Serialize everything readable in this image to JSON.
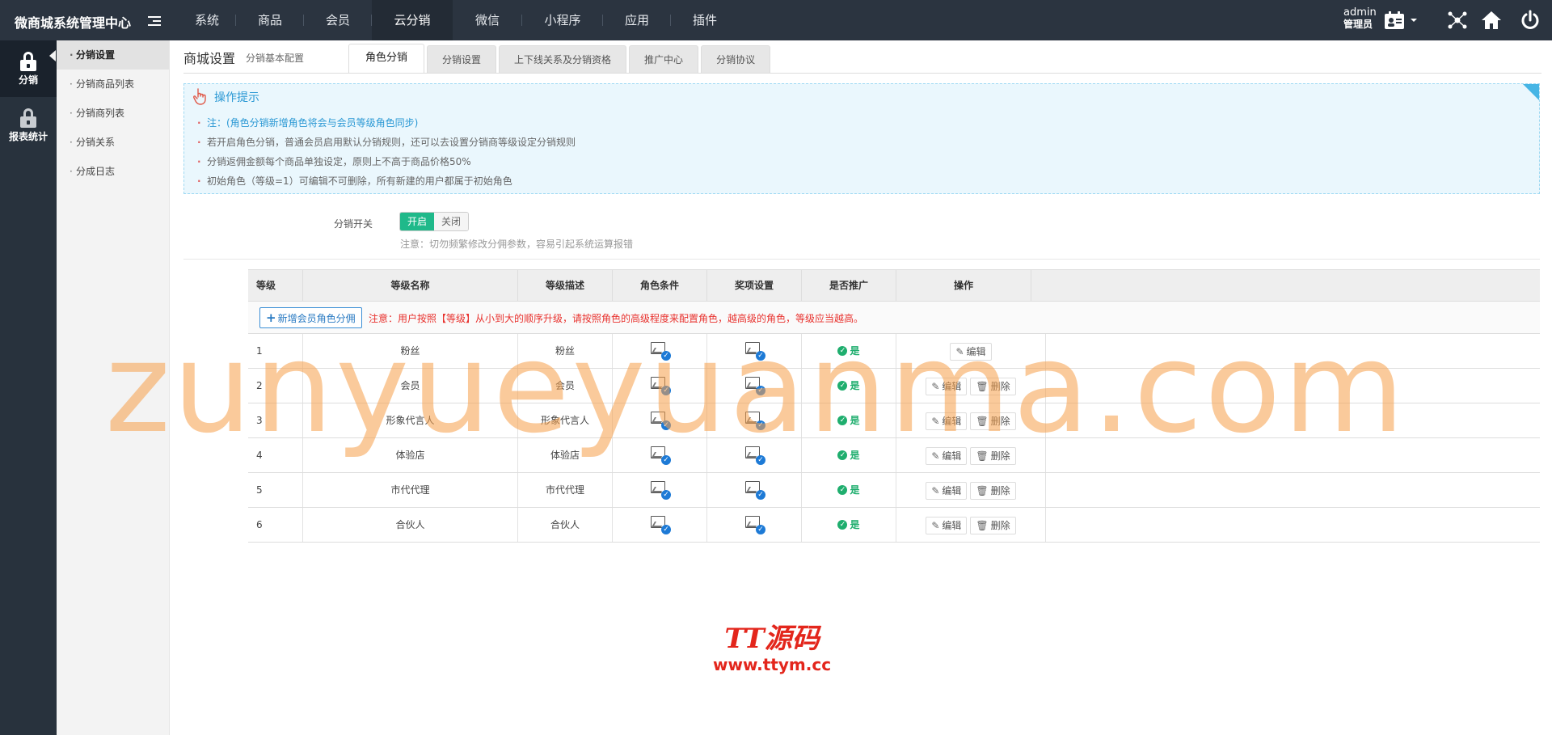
{
  "brand": "微商城系统管理中心",
  "nav": [
    {
      "label": "系统",
      "active": false
    },
    {
      "label": "商品",
      "active": false
    },
    {
      "label": "会员",
      "active": false
    },
    {
      "label": "云分销",
      "active": true
    },
    {
      "label": "微信",
      "active": false
    },
    {
      "label": "小程序",
      "active": false
    },
    {
      "label": "应用",
      "active": false
    },
    {
      "label": "插件",
      "active": false
    }
  ],
  "user": {
    "name": "admin",
    "role": "管理员"
  },
  "sidebar": [
    {
      "label": "分销",
      "icon": "lock-icon",
      "active": true
    },
    {
      "label": "报表统计",
      "icon": "lock-icon",
      "active": false
    }
  ],
  "submenu": [
    {
      "label": "分销设置",
      "active": true
    },
    {
      "label": "分销商品列表",
      "active": false
    },
    {
      "label": "分销商列表",
      "active": false
    },
    {
      "label": "分销关系",
      "active": false
    },
    {
      "label": "分成日志",
      "active": false
    }
  ],
  "page": {
    "title": "商城设置",
    "subtitle": "分销基本配置"
  },
  "tabs": [
    {
      "label": "角色分销",
      "active": true
    },
    {
      "label": "分销设置",
      "active": false
    },
    {
      "label": "上下线关系及分销资格",
      "active": false
    },
    {
      "label": "推广中心",
      "active": false
    },
    {
      "label": "分销协议",
      "active": false
    }
  ],
  "tips": {
    "title": "操作提示",
    "items": [
      "注：(角色分销新增角色将会与会员等级角色同步)",
      "若开启角色分销，普通会员启用默认分销规则，还可以去设置分销商等级设定分销规则",
      "分销返佣金额每个商品单独设定，原则上不高于商品价格50%",
      "初始角色（等级=1）可编辑不可删除，所有新建的用户都属于初始角色"
    ]
  },
  "switch": {
    "label": "分销开关",
    "on_label": "开启",
    "off_label": "关闭",
    "value": "开启",
    "note": "注意：切勿频繁修改分佣参数，容易引起系统运算报错"
  },
  "table": {
    "columns": [
      "等级",
      "等级名称",
      "等级描述",
      "角色条件",
      "奖项设置",
      "是否推广",
      "操作"
    ],
    "add_button": "新增会员角色分佣",
    "notice": "注意：用户按照【等级】从小到大的顺序升级，请按照角色的高级程度来配置角色，越高级的角色，等级应当越高。",
    "edit_label": "编辑",
    "delete_label": "删除",
    "yes_label": "是",
    "rows": [
      {
        "level": "1",
        "name": "粉丝",
        "desc": "粉丝",
        "promote": "是",
        "deletable": false
      },
      {
        "level": "2",
        "name": "会员",
        "desc": "会员",
        "promote": "是",
        "deletable": true
      },
      {
        "level": "3",
        "name": "形象代言人",
        "desc": "形象代言人",
        "promote": "是",
        "deletable": true
      },
      {
        "level": "4",
        "name": "体验店",
        "desc": "体验店",
        "promote": "是",
        "deletable": true
      },
      {
        "level": "5",
        "name": "市代代理",
        "desc": "市代代理",
        "promote": "是",
        "deletable": true
      },
      {
        "level": "6",
        "name": "合伙人",
        "desc": "合伙人",
        "promote": "是",
        "deletable": true
      }
    ]
  },
  "watermark": {
    "main": "zunyueyuanma.com",
    "logo": "TT源码",
    "url": "www.ttym.cc"
  },
  "colors": {
    "topbar": "#2b3440",
    "sidebar": "#28323d",
    "accent_green": "#1fb98a",
    "accent_blue": "#2a98d4",
    "notice_red": "#e8312d"
  }
}
